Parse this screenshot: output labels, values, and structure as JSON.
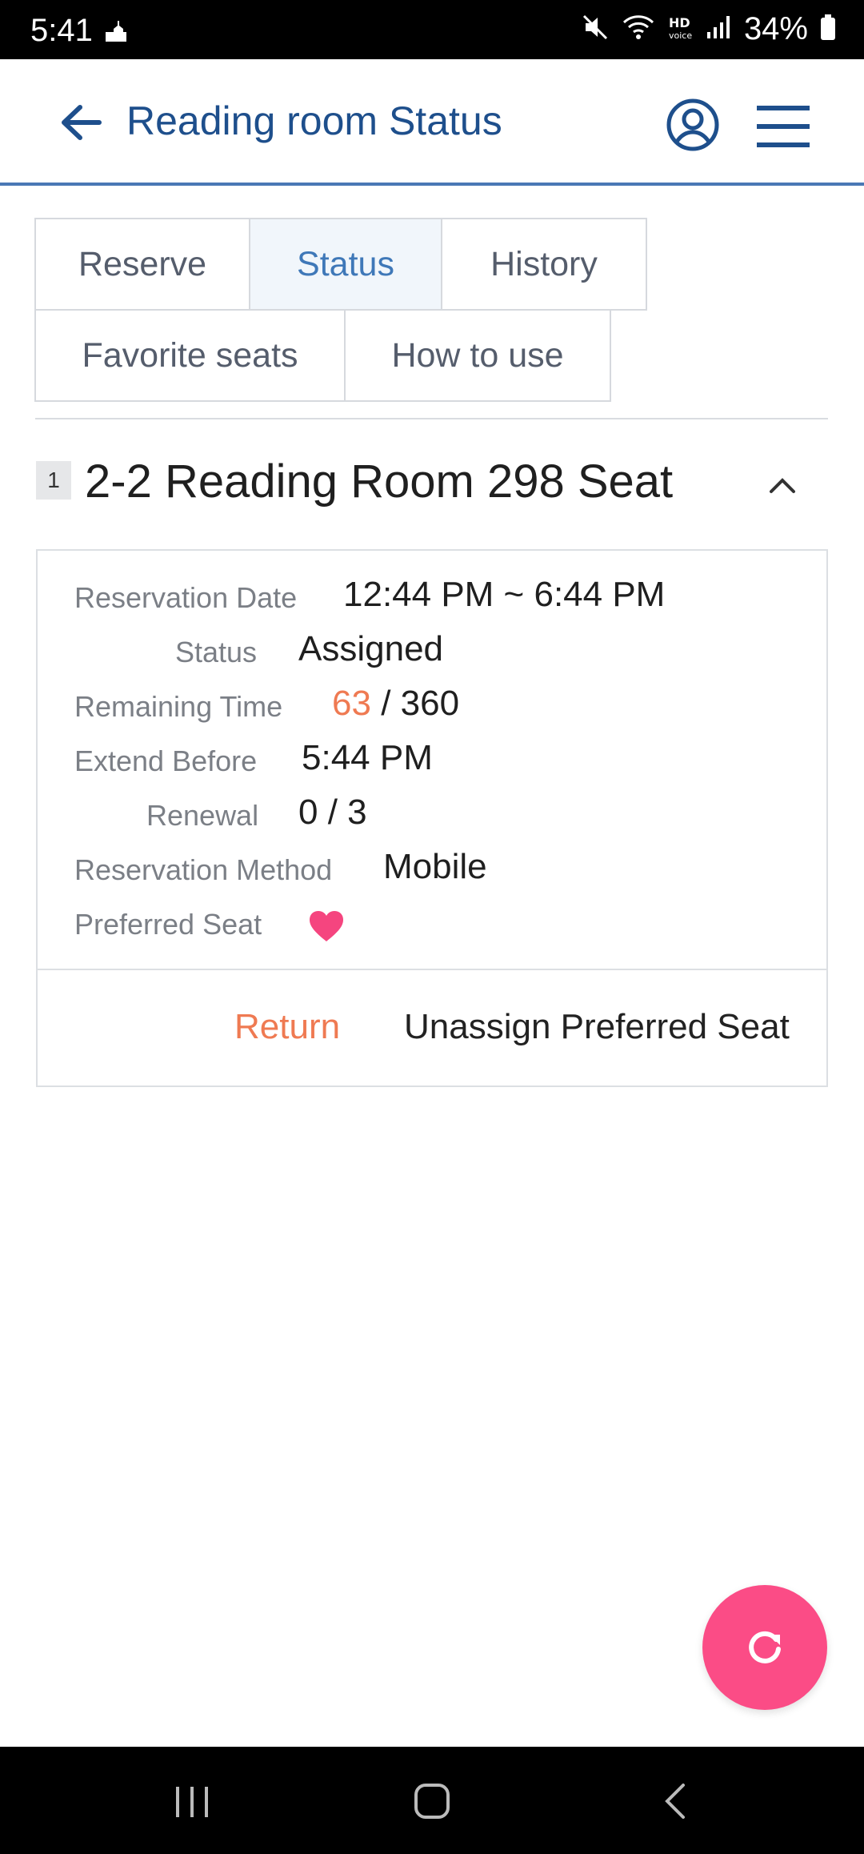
{
  "status_bar": {
    "time": "5:41",
    "battery": "34%",
    "icons": [
      "mosque-icon",
      "mute-icon",
      "wifi-icon",
      "hd-voice-icon",
      "signal-icon",
      "battery-icon"
    ]
  },
  "app_bar": {
    "title": "Reading room Status",
    "back_icon": "arrow-left-icon",
    "profile_icon": "user-circle-icon",
    "menu_icon": "hamburger-icon",
    "accent_color": "#1e4f8c"
  },
  "tabs": [
    {
      "label": "Reserve",
      "active": false
    },
    {
      "label": "Status",
      "active": true
    },
    {
      "label": "History",
      "active": false
    },
    {
      "label": "Favorite seats",
      "active": false
    },
    {
      "label": "How to use",
      "active": false
    }
  ],
  "seat": {
    "index": "1",
    "title": "2-2 Reading Room 298 Seat",
    "collapse_icon": "chevron-up-icon"
  },
  "details": {
    "reservation_date_label": "Reservation Date",
    "reservation_date_value": "12:44 PM ~ 6:44 PM",
    "status_label": "Status",
    "status_value": "Assigned",
    "remaining_label": "Remaining Time",
    "remaining_current": "63",
    "remaining_total": "/ 360",
    "extend_label": "Extend Before",
    "extend_value": "5:44 PM",
    "renewal_label": "Renewal",
    "renewal_value": "0 / 3",
    "method_label": "Reservation Method",
    "method_value": "Mobile",
    "preferred_label": "Preferred Seat",
    "preferred_icon": "heart-icon"
  },
  "actions": {
    "return_label": "Return",
    "unassign_label": "Unassign Preferred Seat"
  },
  "fab": {
    "icon": "refresh-icon",
    "color": "#fb4c86"
  },
  "nav": {
    "recents_icon": "recents-icon",
    "home_icon": "home-icon",
    "back_icon": "back-icon"
  }
}
